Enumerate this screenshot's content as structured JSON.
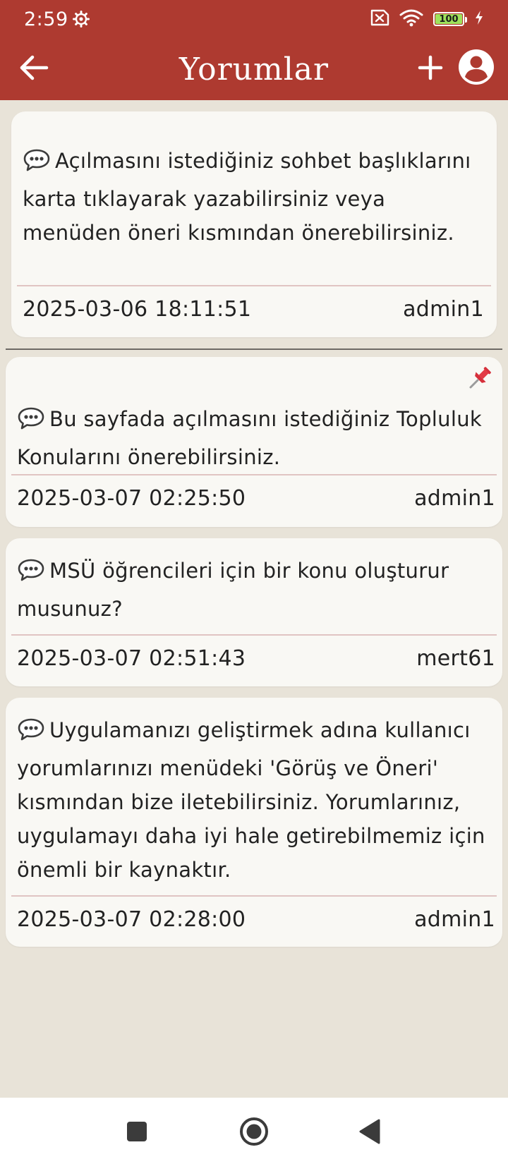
{
  "status_bar": {
    "time": "2:59",
    "battery_level": "100",
    "icons": [
      "gear-icon",
      "no-sim-icon",
      "wifi-icon",
      "battery-icon",
      "charging-icon"
    ]
  },
  "app_bar": {
    "title": "Yorumlar",
    "icons": [
      "back-arrow-icon",
      "plus-icon",
      "account-circle-icon"
    ]
  },
  "comments": [
    {
      "text": "Açılmasını istediğiniz sohbet başlıklarını karta tıklayarak yazabilirsiniz veya menüden öneri kısmından önerebilirsiniz.",
      "timestamp": "2025-03-06 18:11:51",
      "author": "admin1",
      "pinned": false
    },
    {
      "text": "Bu sayfada açılmasını istediğiniz Topluluk Konularını önerebilirsiniz.",
      "timestamp": "2025-03-07 02:25:50",
      "author": "admin1",
      "pinned": true
    },
    {
      "text": "MSÜ öğrencileri için bir konu oluşturur musunuz?",
      "timestamp": "2025-03-07 02:51:43",
      "author": "mert61",
      "pinned": false
    },
    {
      "text": "Uygulamanızı geliştirmek adına kullanıcı yorumlarınızı menüdeki 'Görüş ve Öneri' kısmından bize iletebilirsiniz. Yorumlarınız, uygulamayı daha iyi hale getirebilmemiz için önemli bir kaynaktır.",
      "timestamp": "2025-03-07 02:28:00",
      "author": "admin1",
      "pinned": false
    }
  ],
  "nav_bar": {
    "icons": [
      "recents-square-icon",
      "home-circle-icon",
      "back-triangle-icon"
    ]
  },
  "colors": {
    "primary": "#ae3a30",
    "background": "#e8e3d8",
    "card": "#f9f8f4",
    "divider": "#e0c4c2"
  }
}
